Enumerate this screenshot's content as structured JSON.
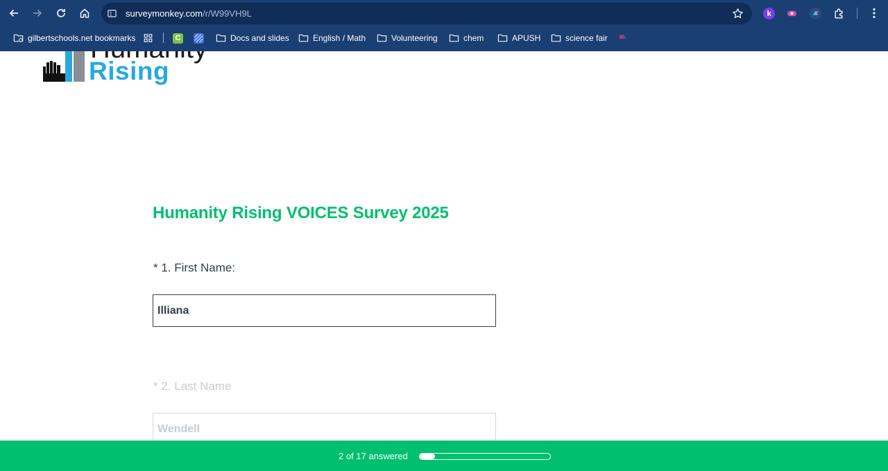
{
  "browser": {
    "url_host": "surveymonkey.com",
    "url_path": "/r/W99VH9L",
    "bookmarks": [
      {
        "label": "gilbertschools.net bookmarks",
        "icon": "managed-folder-icon"
      },
      {
        "label": "",
        "icon": "apps-grid-icon"
      },
      {
        "label": "",
        "icon": "c-app-icon"
      },
      {
        "label": "",
        "icon": "striped-app-icon"
      },
      {
        "label": "Docs and slides",
        "icon": "folder-icon"
      },
      {
        "label": "English / Math",
        "icon": "folder-icon"
      },
      {
        "label": "Volunteering",
        "icon": "folder-icon"
      },
      {
        "label": "chem",
        "icon": "folder-icon"
      },
      {
        "label": "APUSH",
        "icon": "folder-icon"
      },
      {
        "label": "science fair",
        "icon": "folder-icon"
      },
      {
        "label": "",
        "icon": "flag-app-icon"
      }
    ],
    "extension_k_letter": "k"
  },
  "logo": {
    "line1": "Humanity",
    "line2": "Rising"
  },
  "survey": {
    "title": "Humanity Rising VOICES Survey 2025",
    "questions": [
      {
        "label": "* 1. First Name:",
        "value": "Illiana"
      },
      {
        "label": "* 2. Last Name",
        "value": "Wendell"
      }
    ]
  },
  "progress": {
    "text": "2 of 17 answered",
    "answered": 2,
    "total": 17
  },
  "colors": {
    "chrome": "#1a3f73",
    "brand_green": "#00bf6f",
    "logo_blue": "#29a8e0",
    "text": "#333e48"
  }
}
